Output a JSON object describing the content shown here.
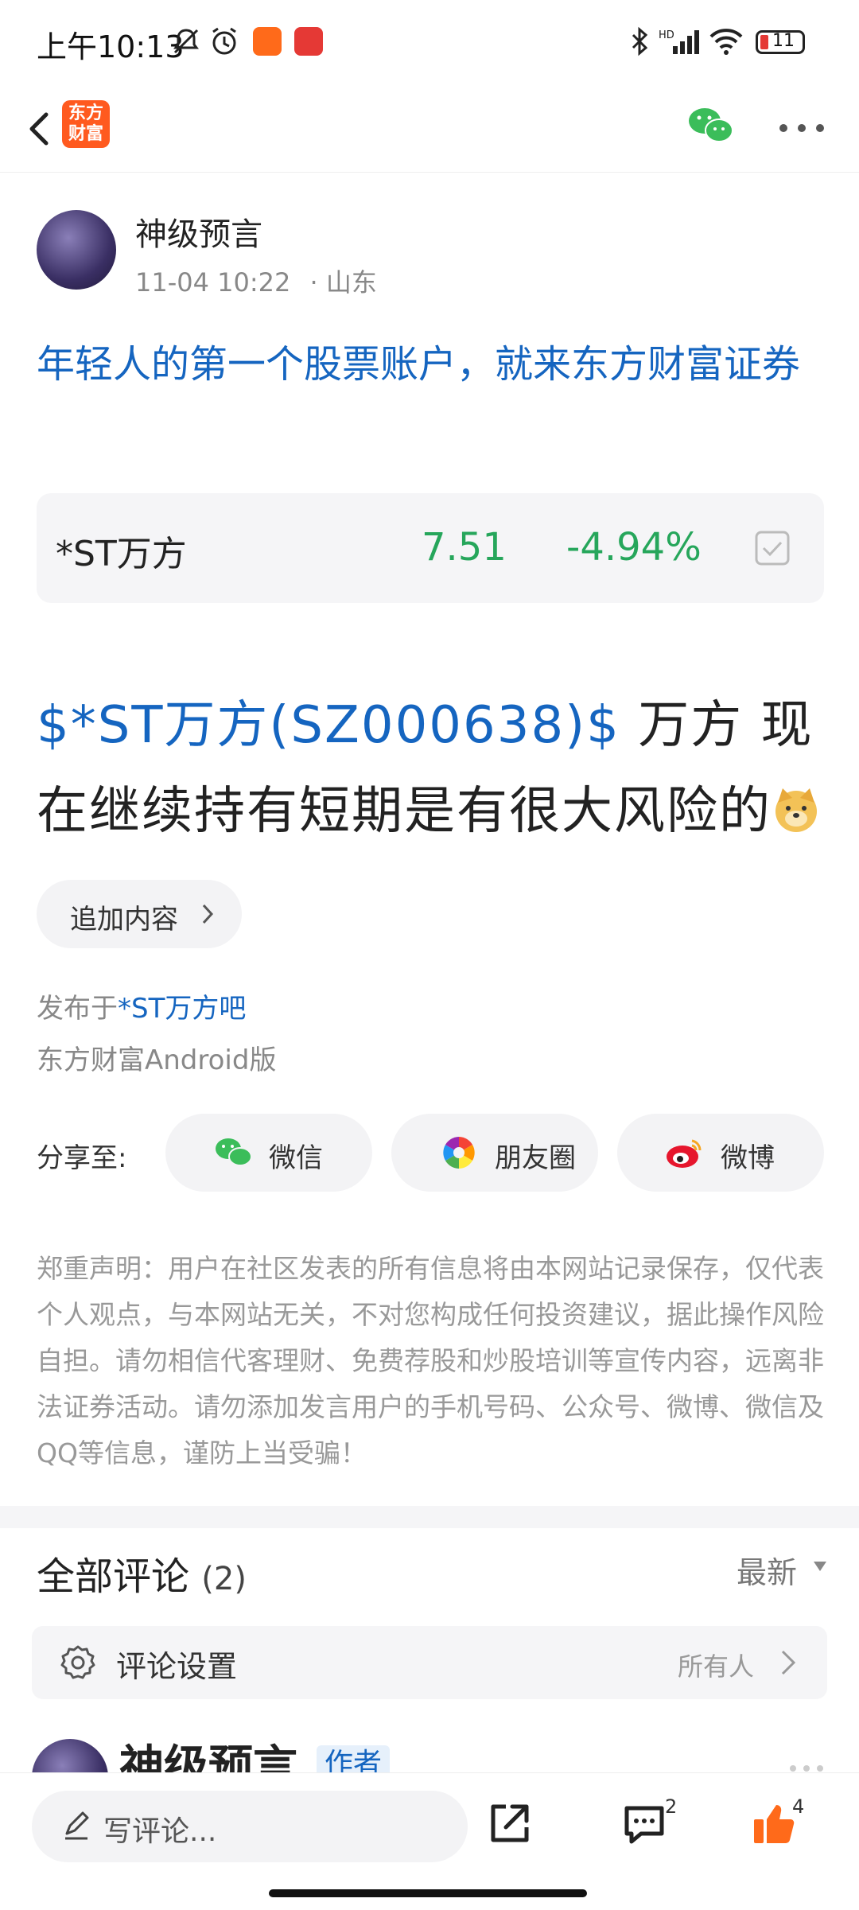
{
  "status_bar": {
    "time": "上午10:13",
    "battery": "11"
  },
  "nav": {
    "logo_text": "东方财富",
    "icons": [
      "back-icon",
      "wechat-icon",
      "more-icon"
    ]
  },
  "post": {
    "author": "神级预言",
    "datetime": "11-04 10:22",
    "location": "· 山东",
    "headline": "年轻人的第一个股票账户，就来东方财富证券",
    "stock": {
      "name": "*ST万方",
      "price": "7.51",
      "change": "-4.94%",
      "color": "#26a65b"
    },
    "body_link": "$*ST万方(SZ000638)$",
    "body_text": " 万方 现在继续持有短期是有很大风险的",
    "append_label": "追加内容",
    "posted_prefix": "发布于",
    "posted_board": "*ST万方吧",
    "platform": "东方财富Android版"
  },
  "share": {
    "label": "分享至:",
    "items": [
      {
        "label": "微信",
        "icon": "wechat-icon"
      },
      {
        "label": "朋友圈",
        "icon": "moments-icon"
      },
      {
        "label": "微博",
        "icon": "weibo-icon"
      }
    ]
  },
  "disclaimer": "郑重声明：用户在社区发表的所有信息将由本网站记录保存，仅代表个人观点，与本网站无关，不对您构成任何投资建议，据此操作风险自担。请勿相信代客理财、免费荐股和炒股培训等宣传内容，远离非法证券活动。请勿添加发言用户的手机号码、公众号、微博、微信及QQ等信息，谨防上当受骗！",
  "comments": {
    "title": "全部评论",
    "count": "(2)",
    "sort": "最新",
    "setting_label": "评论设置",
    "setting_value": "所有人",
    "first_author": "神级预言",
    "author_badge": "作者"
  },
  "bottom_bar": {
    "write_placeholder": "写评论...",
    "comment_count": "2",
    "like_count": "4",
    "like_color": "#ff6a1a"
  },
  "colors": {
    "link": "#1565c0",
    "up_down": "#26a65b",
    "brand": "#ff5a1f"
  }
}
